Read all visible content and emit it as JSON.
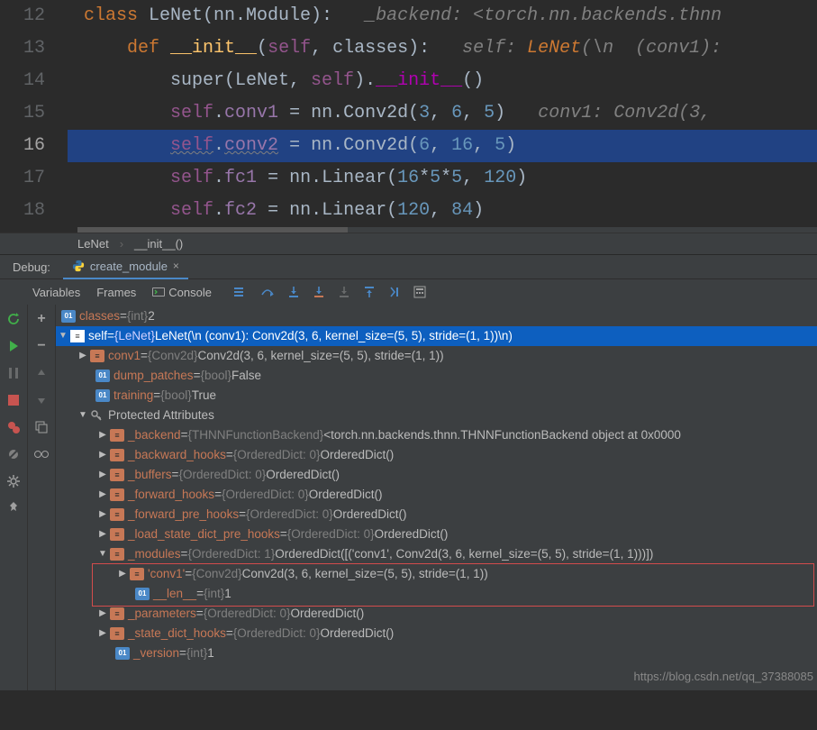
{
  "editor": {
    "lines": [
      {
        "num": "12"
      },
      {
        "num": "13"
      },
      {
        "num": "14"
      },
      {
        "num": "15"
      },
      {
        "num": "16"
      },
      {
        "num": "17"
      },
      {
        "num": "18"
      }
    ],
    "l12": {
      "kw": "class ",
      "cls": "LeNet",
      "rest": "(nn.Module):",
      "hint": "_backend: <torch.nn.backends.thnn"
    },
    "l13": {
      "kw": "def ",
      "fn": "__init__",
      "sig_open": "(",
      "self": "self",
      "sig_rest": ", classes):",
      "hint_pre": "self: ",
      "hint_cls": "LeNet",
      "hint_post": "(\\n  (conv1):"
    },
    "l14": {
      "super_open": "super(LeNet, ",
      "self": "self",
      "super_mid": ").",
      "dunder": "__init__",
      "close": "()"
    },
    "l15": {
      "self": "self",
      "dot": ".",
      "attr": "conv1",
      "eq": " = nn.Conv2d(",
      "a": "3",
      "c1": ", ",
      "b": "6",
      "c2": ", ",
      "c": "5",
      "close": ")",
      "hint": "conv1: Conv2d(3, "
    },
    "l16": {
      "self": "self",
      "dot": ".",
      "attr": "conv2",
      "eq": " = nn.Conv2d(",
      "a": "6",
      "c1": ", ",
      "b": "16",
      "c2": ", ",
      "c": "5",
      "close": ")"
    },
    "l17": {
      "self": "self",
      "dot": ".",
      "attr": "fc1",
      "eq": " = nn.Linear(",
      "a": "16",
      "star1": "*",
      "b": "5",
      "star2": "*",
      "c": "5",
      "c2": ", ",
      "d": "120",
      "close": ")"
    },
    "l18": {
      "self": "self",
      "dot": ".",
      "attr": "fc2",
      "eq": " = nn.Linear(",
      "a": "120",
      "c1": ", ",
      "b": "84",
      "close": ")"
    }
  },
  "crumbs": {
    "a": "LeNet",
    "b": "__init__()"
  },
  "debug": {
    "label": "Debug:",
    "tab": "create_module"
  },
  "tools": {
    "vars": "Variables",
    "frames": "Frames",
    "console": "Console"
  },
  "tree": {
    "classes": {
      "name": "classes",
      "eq": " = ",
      "type": "{int}",
      "val": " 2"
    },
    "self": {
      "name": "self",
      "eq": " = ",
      "type": "{LeNet}",
      "val": " LeNet(\\n  (conv1): Conv2d(3, 6, kernel_size=(5, 5), stride=(1, 1))\\n)"
    },
    "conv1": {
      "name": "conv1",
      "eq": " = ",
      "type": "{Conv2d}",
      "val": " Conv2d(3, 6, kernel_size=(5, 5), stride=(1, 1))"
    },
    "dump": {
      "name": "dump_patches",
      "eq": " = ",
      "type": "{bool}",
      "val": " False"
    },
    "training": {
      "name": "training",
      "eq": " = ",
      "type": "{bool}",
      "val": " True"
    },
    "prot": "Protected Attributes",
    "backend": {
      "name": "_backend",
      "eq": " = ",
      "type": "{THNNFunctionBackend}",
      "val": " <torch.nn.backends.thnn.THNNFunctionBackend object at 0x0000"
    },
    "bhooks": {
      "name": "_backward_hooks",
      "eq": " = ",
      "type": "{OrderedDict: 0}",
      "val": " OrderedDict()"
    },
    "buffers": {
      "name": "_buffers",
      "eq": " = ",
      "type": "{OrderedDict: 0}",
      "val": " OrderedDict()"
    },
    "fhooks": {
      "name": "_forward_hooks",
      "eq": " = ",
      "type": "{OrderedDict: 0}",
      "val": " OrderedDict()"
    },
    "fphooks": {
      "name": "_forward_pre_hooks",
      "eq": " = ",
      "type": "{OrderedDict: 0}",
      "val": " OrderedDict()"
    },
    "lhooks": {
      "name": "_load_state_dict_pre_hooks",
      "eq": " = ",
      "type": "{OrderedDict: 0}",
      "val": " OrderedDict()"
    },
    "modules": {
      "name": "_modules",
      "eq": " = ",
      "type": "{OrderedDict: 1}",
      "val": " OrderedDict([('conv1', Conv2d(3, 6, kernel_size=(5, 5), stride=(1, 1)))])"
    },
    "mconv1": {
      "name": "'conv1'",
      "eq": " = ",
      "type": "{Conv2d}",
      "val": " Conv2d(3, 6, kernel_size=(5, 5), stride=(1, 1))"
    },
    "len": {
      "name": "__len__",
      "eq": " = ",
      "type": "{int}",
      "val": " 1"
    },
    "params": {
      "name": "_parameters",
      "eq": " = ",
      "type": "{OrderedDict: 0}",
      "val": " OrderedDict()"
    },
    "shooks": {
      "name": "_state_dict_hooks",
      "eq": " = ",
      "type": "{OrderedDict: 0}",
      "val": " OrderedDict()"
    },
    "version": {
      "name": "_version",
      "eq": " = ",
      "type": "{int}",
      "val": " 1"
    }
  },
  "watermark": "https://blog.csdn.net/qq_37388085"
}
